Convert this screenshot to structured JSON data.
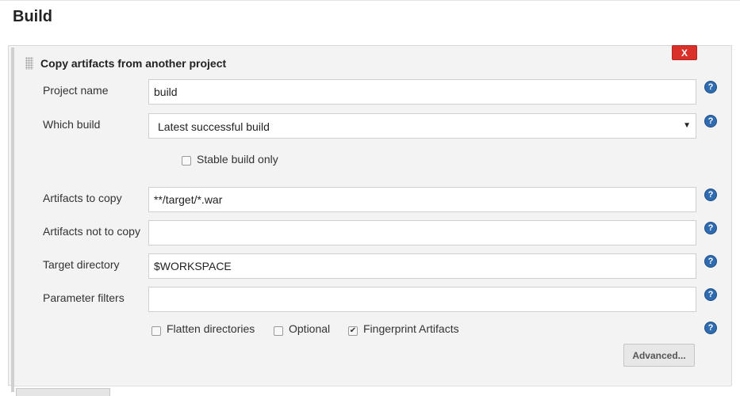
{
  "section": {
    "title": "Build"
  },
  "block": {
    "title": "Copy artifacts from another project",
    "delete_label": "X"
  },
  "fields": {
    "project_name": {
      "label": "Project name",
      "value": "build"
    },
    "which_build": {
      "label": "Which build",
      "value": "Latest successful build"
    },
    "stable_build_only": {
      "label": "Stable build only",
      "checked": false
    },
    "artifacts_to_copy": {
      "label": "Artifacts to copy",
      "value": "**/target/*.war"
    },
    "artifacts_not_to_copy": {
      "label": "Artifacts not to copy",
      "value": ""
    },
    "target_directory": {
      "label": "Target directory",
      "value": "$WORKSPACE"
    },
    "parameter_filters": {
      "label": "Parameter filters",
      "value": ""
    }
  },
  "options": {
    "flatten": {
      "label": "Flatten directories",
      "checked": false
    },
    "optional": {
      "label": "Optional",
      "checked": false
    },
    "fingerprint": {
      "label": "Fingerprint Artifacts",
      "checked": true
    }
  },
  "buttons": {
    "advanced": "Advanced...",
    "help": "?"
  },
  "colors": {
    "delete": "#d9302a",
    "help": "#2f6bb0"
  }
}
